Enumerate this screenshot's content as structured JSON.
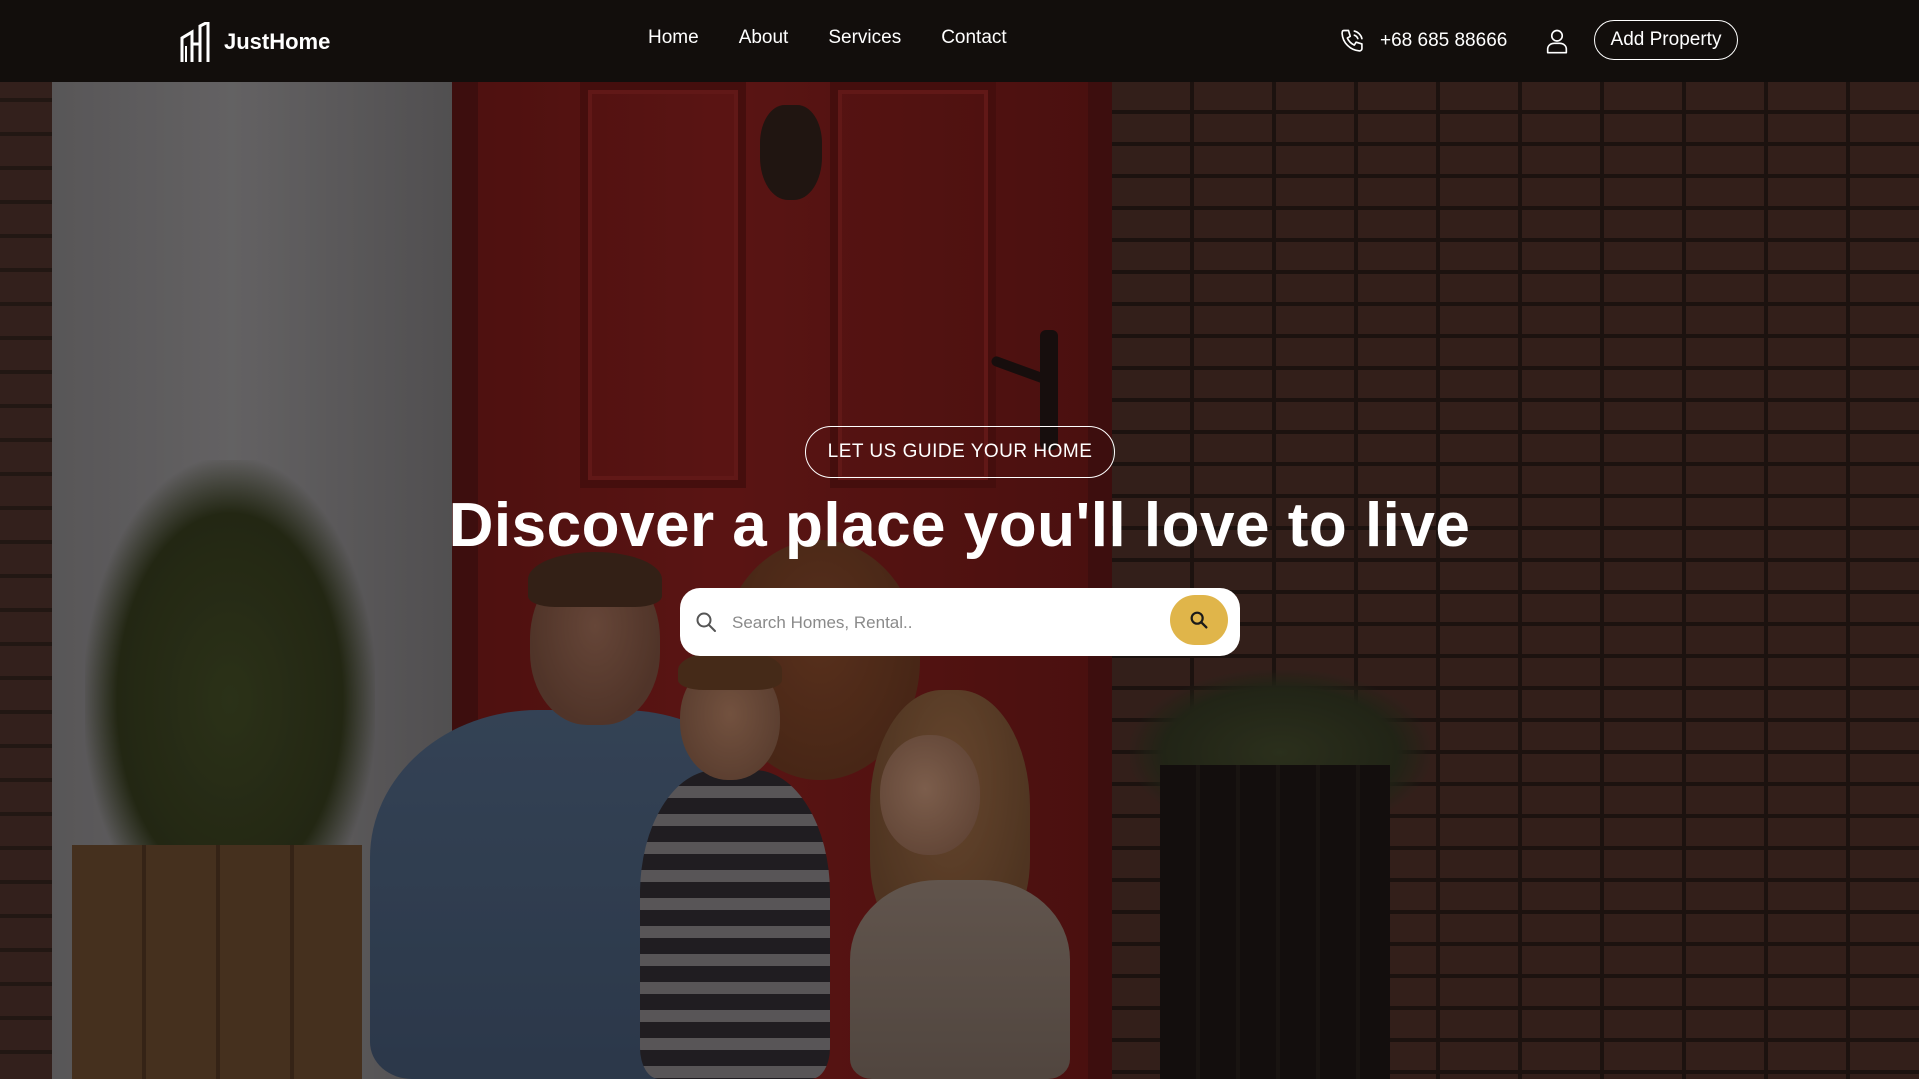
{
  "brand": {
    "name": "JustHome",
    "logo_icon": "building-logo-icon"
  },
  "nav": {
    "items": [
      {
        "label": "Home"
      },
      {
        "label": "About"
      },
      {
        "label": "Services"
      },
      {
        "label": "Contact"
      }
    ]
  },
  "header_actions": {
    "phone_icon": "phone-icon",
    "phone_number": "+68 685 88666",
    "user_icon": "user-icon",
    "add_property_label": "Add Property"
  },
  "hero": {
    "badge": "LET US GUIDE YOUR HOME",
    "title": "Discover a place you'll love to live",
    "background_image": "family-sitting-on-porch-in-front-of-red-door",
    "search": {
      "leading_icon": "search-icon",
      "placeholder": "Search Homes, Rental..",
      "value": "",
      "button_icon": "search-icon"
    }
  },
  "colors": {
    "header_bg": "#120e0c",
    "accent": "#e0b54a",
    "text": "#ffffff"
  }
}
